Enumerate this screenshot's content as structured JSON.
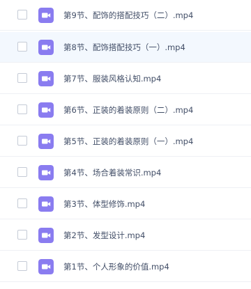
{
  "colors": {
    "video_icon": "#8a7cf0",
    "row_highlight": "#f3f8fe",
    "text": "#424e67"
  },
  "icons": {
    "file_type": "video-icon"
  },
  "files": [
    {
      "name": "第9节、配饰的搭配技巧（二）.mp4",
      "checked": false,
      "highlighted": false
    },
    {
      "name": "第8节、配饰搭配技巧（一）.mp4",
      "checked": false,
      "highlighted": true
    },
    {
      "name": "第7节、服装风格认知.mp4",
      "checked": false,
      "highlighted": false
    },
    {
      "name": "第6节、正装的着装原则（二）.mp4",
      "checked": false,
      "highlighted": false
    },
    {
      "name": "第5节、正装的着装原则（一）.mp4",
      "checked": false,
      "highlighted": false
    },
    {
      "name": "第4节、场合着装常识.mp4",
      "checked": false,
      "highlighted": false
    },
    {
      "name": "第3节、体型修饰.mp4",
      "checked": false,
      "highlighted": false
    },
    {
      "name": "第2节、发型设计.mp4",
      "checked": false,
      "highlighted": false
    },
    {
      "name": "第1节、个人形象的价值.mp4",
      "checked": false,
      "highlighted": false
    }
  ]
}
